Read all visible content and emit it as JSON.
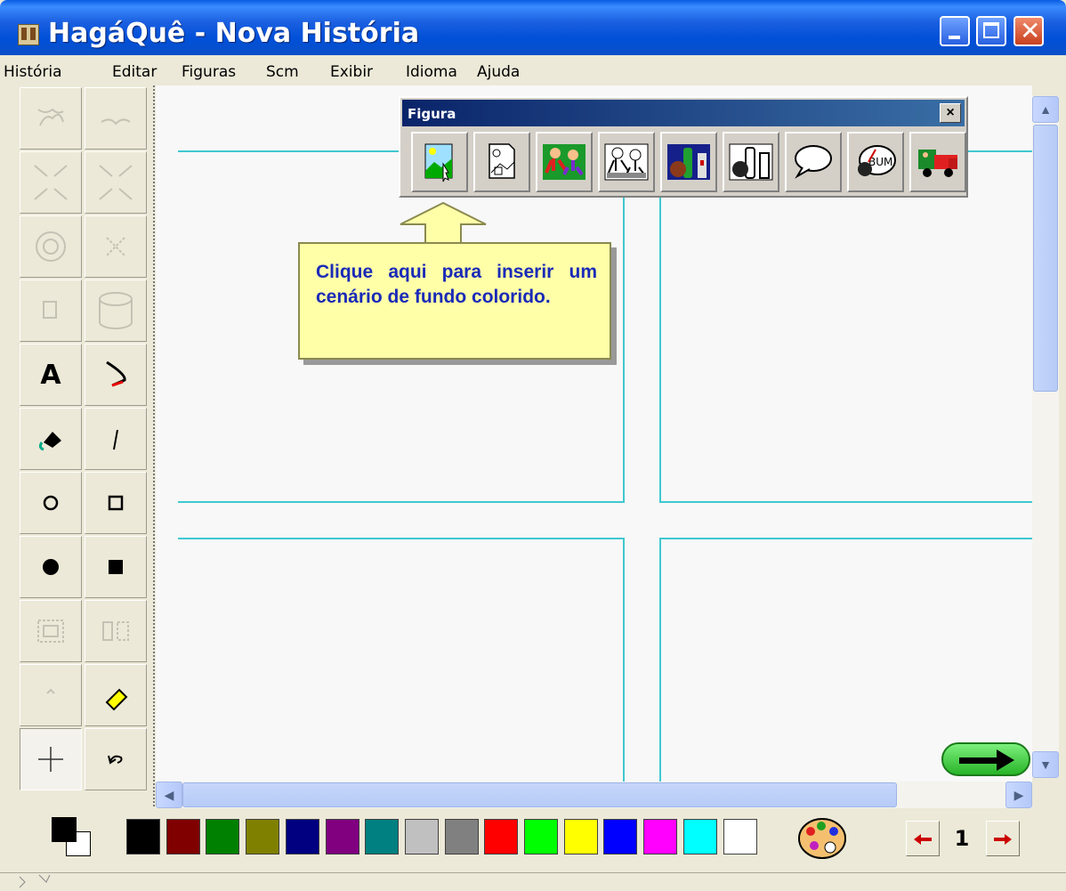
{
  "window": {
    "title": "HagáQuê - Nova História"
  },
  "menu": [
    "História",
    "Editar",
    "Figuras",
    "Scm",
    "Exibir",
    "Idioma",
    "Ajuda"
  ],
  "toolbox": {
    "text_tool": "A"
  },
  "figura_toolbar": {
    "title": "Figura",
    "close": "×",
    "buttons": [
      "cenario-colorido-icon",
      "cenario-contorno-icon",
      "personagem-colorido-icon",
      "personagem-contorno-icon",
      "objeto-colorido-icon",
      "objeto-contorno-icon",
      "balao-fala-icon",
      "onomatopeia-icon",
      "transporte-icon"
    ]
  },
  "callout": {
    "text": "Clique aqui para inserir um cenário de fundo colorido."
  },
  "palette": {
    "colors": [
      "#000000",
      "#800000",
      "#008000",
      "#808000",
      "#000080",
      "#800080",
      "#008080",
      "#c0c0c0",
      "#808080",
      "#ff0000",
      "#00ff00",
      "#ffff00",
      "#0000ff",
      "#ff00ff",
      "#00ffff",
      "#ffffff"
    ]
  },
  "pager": {
    "page": "1"
  }
}
